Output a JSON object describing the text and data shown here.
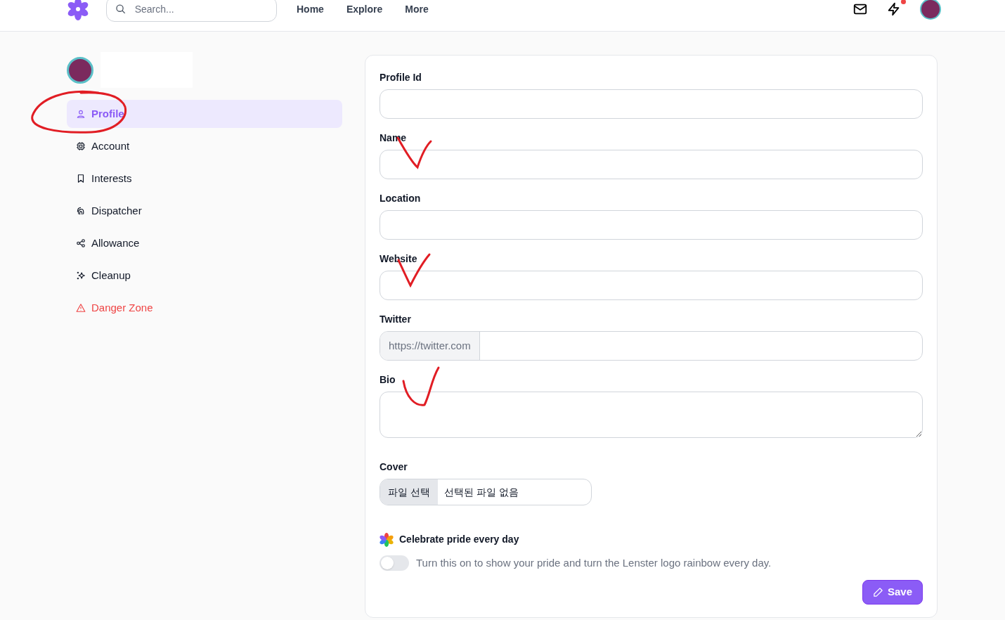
{
  "header": {
    "search": {
      "placeholder": "Search..."
    },
    "nav": [
      {
        "label": "Home"
      },
      {
        "label": "Explore"
      },
      {
        "label": "More"
      }
    ]
  },
  "sidebar": {
    "items": [
      {
        "label": "Profile",
        "selected": true,
        "danger": false
      },
      {
        "label": "Account",
        "selected": false,
        "danger": false
      },
      {
        "label": "Interests",
        "selected": false,
        "danger": false
      },
      {
        "label": "Dispatcher",
        "selected": false,
        "danger": false
      },
      {
        "label": "Allowance",
        "selected": false,
        "danger": false
      },
      {
        "label": "Cleanup",
        "selected": false,
        "danger": false
      },
      {
        "label": "Danger Zone",
        "selected": false,
        "danger": true
      }
    ]
  },
  "form": {
    "fields": [
      {
        "kind": "text",
        "label": "Profile Id"
      },
      {
        "kind": "text",
        "label": "Name"
      },
      {
        "kind": "text",
        "label": "Location"
      },
      {
        "kind": "text",
        "label": "Website"
      },
      {
        "kind": "prefixed",
        "label": "Twitter",
        "prefix": "https://twitter.com"
      },
      {
        "kind": "textarea",
        "label": "Bio"
      },
      {
        "kind": "file",
        "label": "Cover",
        "button": "파일 선택",
        "status": "선택된 파일 없음"
      }
    ],
    "pride": {
      "title": "Celebrate pride every day",
      "description": "Turn this on to show your pride and turn the Lenster logo rainbow every day.",
      "on": false
    },
    "save_button": "Save"
  }
}
